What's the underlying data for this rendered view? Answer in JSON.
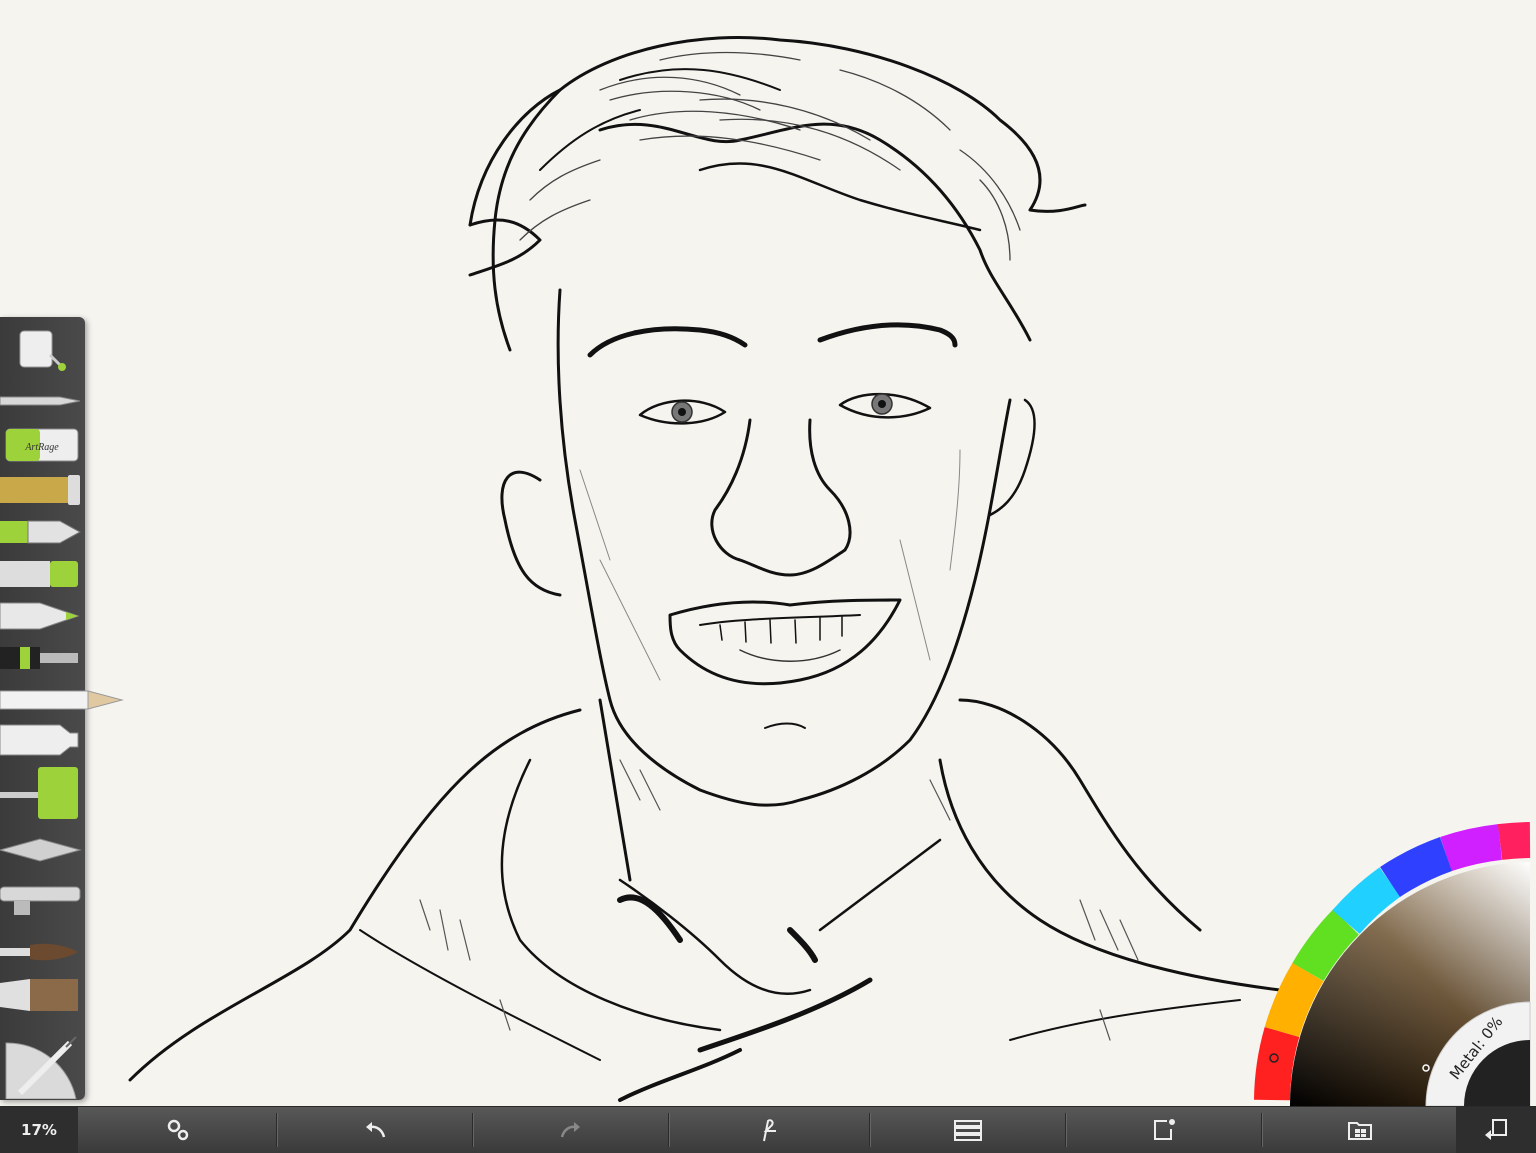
{
  "app": "ArtRage",
  "toolbox": {
    "items": [
      {
        "name": "glitter-tool",
        "icon": "paint-bucket-icon"
      },
      {
        "name": "palette-knife-tool",
        "icon": "knife-icon"
      },
      {
        "name": "sticker-tool",
        "icon": "artrage-sticker-icon",
        "label": "ArtRage"
      },
      {
        "name": "glitter-tube-tool",
        "icon": "glitter-icon"
      },
      {
        "name": "ink-pen-tool",
        "icon": "ink-pen-icon"
      },
      {
        "name": "felt-pen-tool",
        "icon": "felt-pen-icon"
      },
      {
        "name": "marker-tool",
        "icon": "marker-icon"
      },
      {
        "name": "technical-pen-tool",
        "icon": "technical-pen-icon"
      },
      {
        "name": "pencil-tool",
        "icon": "pencil-icon"
      },
      {
        "name": "paint-tube-tool",
        "icon": "paint-tube-icon"
      },
      {
        "name": "paint-roller-tool",
        "icon": "paint-roller-icon"
      },
      {
        "name": "spatula-tool",
        "icon": "spatula-icon"
      },
      {
        "name": "airbrush-tool",
        "icon": "airbrush-icon"
      },
      {
        "name": "watercolor-brush-tool",
        "icon": "brush-icon"
      },
      {
        "name": "oil-brush-tool",
        "icon": "flat-brush-icon"
      }
    ],
    "active": "pencil-tool"
  },
  "colorpicker": {
    "metal_label": "Metal: 0%",
    "current_color": "#111111"
  },
  "bottombar": {
    "zoom": "17%",
    "buttons": [
      {
        "name": "settings-button",
        "icon": "gears-icon"
      },
      {
        "name": "undo-button",
        "icon": "undo-icon"
      },
      {
        "name": "redo-button",
        "icon": "redo-icon"
      },
      {
        "name": "tracing-button",
        "icon": "tracing-icon"
      },
      {
        "name": "layers-button",
        "icon": "layers-icon"
      },
      {
        "name": "share-button",
        "icon": "share-icon"
      },
      {
        "name": "gallery-button",
        "icon": "gallery-icon"
      },
      {
        "name": "exit-button",
        "icon": "exit-icon"
      }
    ]
  }
}
